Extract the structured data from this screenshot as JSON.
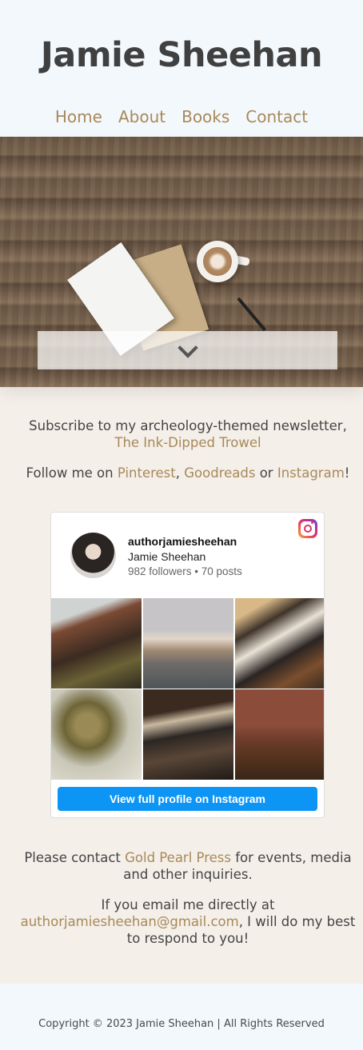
{
  "header": {
    "site_title": "Jamie Sheehan",
    "nav": [
      {
        "label": "Home"
      },
      {
        "label": "About"
      },
      {
        "label": "Books"
      },
      {
        "label": "Contact"
      }
    ]
  },
  "hero": {
    "scroll_icon": "chevron-down-icon"
  },
  "intro": {
    "newsletter_prefix": "Subscribe to my archeology-themed newsletter, ",
    "newsletter_link": "The Ink-Dipped Trowel",
    "follow_prefix": "Follow me on ",
    "pinterest": "Pinterest",
    "sep1": ", ",
    "goodreads": "Goodreads",
    "sep2": " or ",
    "instagram": "Instagram",
    "follow_suffix": "!"
  },
  "instagram_widget": {
    "username": "authorjamiesheehan",
    "name": "Jamie Sheehan",
    "stats": "982 followers • 70 posts",
    "button_label": "View full profile on Instagram",
    "logo_icon": "instagram-icon"
  },
  "contact": {
    "prefix": "Please contact ",
    "press_link": "Gold Pearl Press",
    "suffix": " for events, media and other inquiries.",
    "email_prefix": "If you email me directly at ",
    "email_link": "authorjamiesheehan@gmail.com",
    "email_suffix": ", I will do my best to respond to you!"
  },
  "footer": {
    "copyright": "Copyright © 2023 Jamie Sheehan | All Rights Reserved"
  },
  "colors": {
    "accent": "#a8895a",
    "header_bg": "#f3f8fc",
    "body_bg": "#f4efe9",
    "instagram_button": "#0d95f5"
  }
}
